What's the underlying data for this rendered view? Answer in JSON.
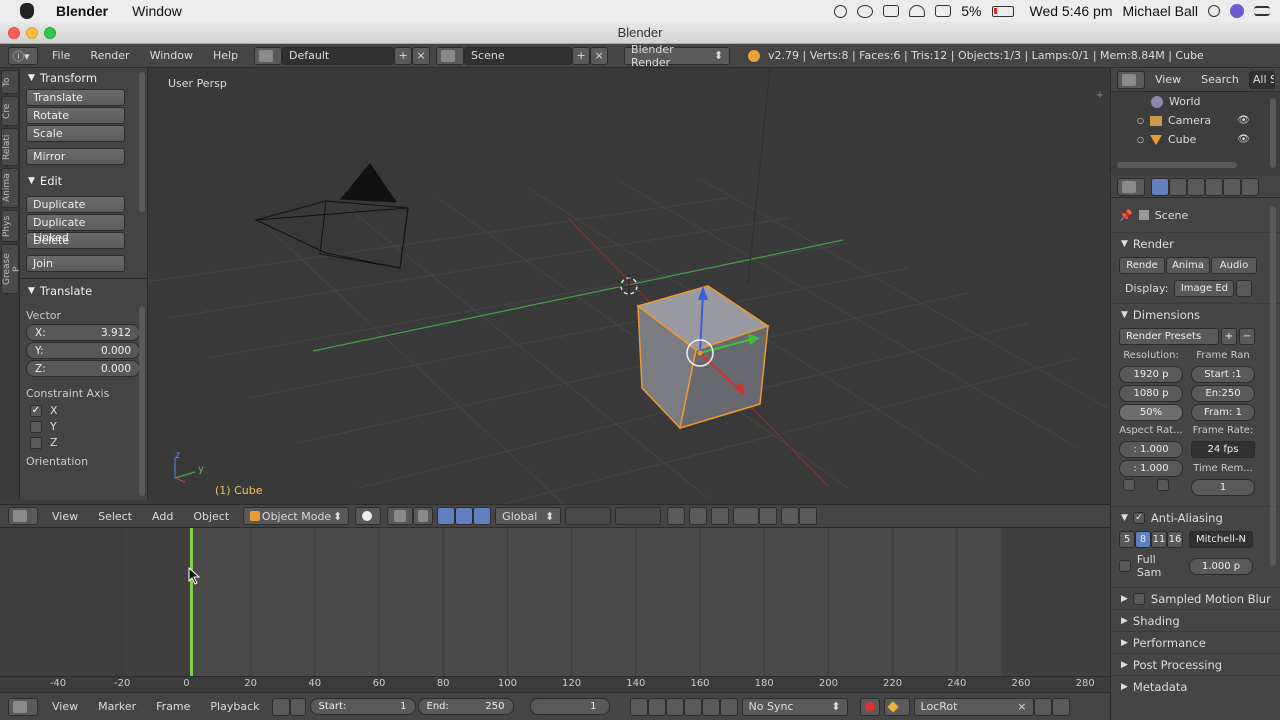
{
  "mac_menubar": {
    "app": "Blender",
    "menu_window": "Window",
    "battery": "5%",
    "clock": "Wed 5:46 pm",
    "user": "Michael Ball"
  },
  "window": {
    "title": "Blender"
  },
  "info_header": {
    "menus": [
      "File",
      "Render",
      "Window",
      "Help"
    ],
    "screen_layout": "Default",
    "scene": "Scene",
    "render_engine": "Blender Render",
    "stats": "v2.79 | Verts:8 | Faces:6 | Tris:12 | Objects:1/3 | Lamps:0/1 | Mem:8.84M | Cube"
  },
  "side_tabs": [
    "To",
    "Cre",
    "Relati",
    "Anima",
    "Phys",
    "Grease P"
  ],
  "toolshelf": {
    "transform_header": "Transform",
    "transform_buttons": [
      "Translate",
      "Rotate",
      "Scale"
    ],
    "mirror": "Mirror",
    "edit_header": "Edit",
    "edit_buttons": [
      "Duplicate",
      "Duplicate Linked",
      "Delete"
    ],
    "join": "Join",
    "operator_header": "Translate",
    "vector_label": "Vector",
    "vector": [
      {
        "axis": "X:",
        "value": "3.912"
      },
      {
        "axis": "Y:",
        "value": "0.000"
      },
      {
        "axis": "Z:",
        "value": "0.000"
      }
    ],
    "constraint_label": "Constraint Axis",
    "constraints": [
      {
        "label": "X",
        "checked": true
      },
      {
        "label": "Y",
        "checked": false
      },
      {
        "label": "Z",
        "checked": false
      }
    ],
    "orientation_label": "Orientation"
  },
  "viewport": {
    "view_name": "User Persp",
    "object_label": "(1) Cube",
    "axis_z": "z",
    "axis_y": "y"
  },
  "viewport_header": {
    "menus": [
      "View",
      "Select",
      "Add",
      "Object"
    ],
    "mode": "Object Mode",
    "orientation": "Global"
  },
  "timeline": {
    "ticks": [
      "-40",
      "-20",
      "0",
      "20",
      "40",
      "60",
      "80",
      "100",
      "120",
      "140",
      "160",
      "180",
      "200",
      "220",
      "240",
      "260",
      "280"
    ],
    "current_frame": 1
  },
  "timeline_header": {
    "menus": [
      "View",
      "Marker",
      "Frame",
      "Playback"
    ],
    "start_label": "Start:",
    "start_value": "1",
    "end_label": "End:",
    "end_value": "250",
    "current_value": "1",
    "sync": "No Sync",
    "keying_set": "LocRot"
  },
  "outliner": {
    "menus": [
      "View",
      "Search"
    ],
    "filter": "All S",
    "items": [
      {
        "name": "World"
      },
      {
        "name": "Camera"
      },
      {
        "name": "Cube"
      }
    ]
  },
  "properties": {
    "context": "Scene",
    "render_header": "Render",
    "render_buttons": [
      "Rende",
      "Anima",
      "Audio"
    ],
    "display_label": "Display:",
    "display_value": "Image Ed",
    "dimensions_header": "Dimensions",
    "render_presets": "Render Presets",
    "resolution_label": "Resolution:",
    "frame_range_label": "Frame Ran",
    "res_x": "1920 p",
    "res_y": "1080 p",
    "res_pct": "50%",
    "frame_start": "Start :1",
    "frame_end": "En:250",
    "frame_step": "Fram: 1",
    "aspect_label": "Aspect Rat...",
    "frame_rate_label": "Frame Rate:",
    "aspect_x": ": 1.000",
    "aspect_y": ": 1.000",
    "fps": "24 fps",
    "time_remap_label": "Time Rem...",
    "time_remap_value": "1",
    "aa_header": "Anti-Aliasing",
    "aa_samples": [
      "5",
      "8",
      "11",
      "16"
    ],
    "aa_filter": "Mitchell-N",
    "full_sample": "Full Sam",
    "filter_size": "1.000 p",
    "sampled_motion": "Sampled Motion Blur",
    "collapsed_sections": [
      "Shading",
      "Performance",
      "Post Processing",
      "Metadata"
    ]
  }
}
